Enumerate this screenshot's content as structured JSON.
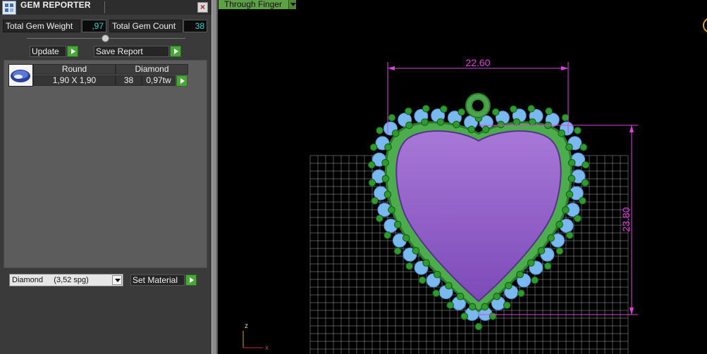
{
  "panel": {
    "title": "GEM REPORTER",
    "close_symbol": "×",
    "total_gem_weight_label": "Total Gem Weight",
    "total_gem_weight_value": ",97",
    "total_gem_count_label": "Total Gem Count",
    "total_gem_count_value": "38",
    "update_label": "Update",
    "save_report_label": "Save Report",
    "table": {
      "columns": [
        "Round",
        "Diamond"
      ],
      "rows": [
        {
          "size": "1,90 X 1,90",
          "count": "38",
          "weight": "0,97tw"
        }
      ]
    },
    "material_select_value": "Diamond     (3,52 spg)",
    "set_material_label": "Set Material"
  },
  "viewport": {
    "mode_label": "Through Finger",
    "dimension_width": "22.60",
    "dimension_height": "23.80",
    "axis_z": "z",
    "axis_x": "x",
    "colors": {
      "dimension": "#e040e0",
      "gem": "#7ab8f0",
      "prong": "#2f9a2f",
      "metal": "#4cad4c",
      "inlay": "#9a6ad0",
      "grid": "#d8d8d8"
    }
  }
}
